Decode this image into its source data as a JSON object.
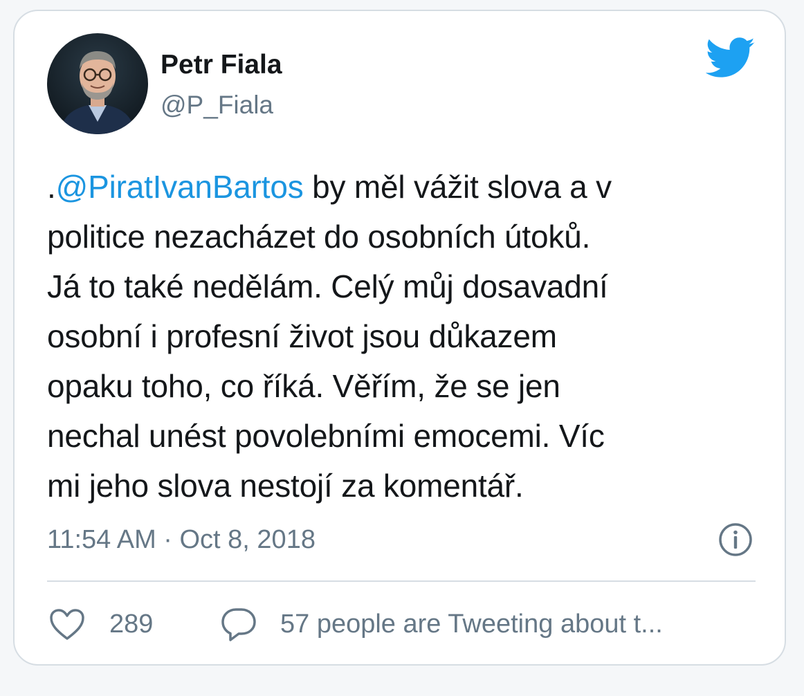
{
  "author": {
    "name": "Petr Fiala",
    "handle": "@P_Fiala"
  },
  "icons": {
    "brand": "twitter-bird-icon",
    "info": "info-icon",
    "like": "heart-icon",
    "reply": "speech-bubble-icon"
  },
  "colors": {
    "brand_blue": "#1da1f2",
    "mention": "#1b95e0",
    "text": "#14171a",
    "secondary": "#657786",
    "border": "#d6dde3"
  },
  "tweet": {
    "mention": "@PiratIvanBartos",
    "lines": [
      {
        "prefix": ".",
        "rest": " by měl vážit slova a v"
      },
      "politice nezacházet do osobních útoků.",
      "Já to také nedělám. Celý můj dosavadní",
      "osobní i profesní život jsou důkazem",
      "opaku toho, co říká. Věřím, že se jen",
      "nechal unést povolebními emocemi. Víc",
      "mi jeho slova nestojí za komentář."
    ]
  },
  "timestamp": "11:54 AM · Oct 8, 2018",
  "actions": {
    "likes": "289",
    "tweeting": "57 people are Tweeting about t..."
  }
}
